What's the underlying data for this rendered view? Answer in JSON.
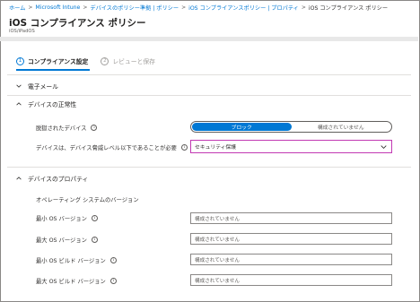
{
  "breadcrumb": {
    "items": [
      "ホーム",
      "Microsoft Intune",
      "デバイスのポリシー準拠 | ポリシー",
      "iOS コンプライアンスポリシー | プロパティ",
      "iOS コンプライアンス ポリシー"
    ],
    "separator": ">"
  },
  "header": {
    "title": "iOS コンプライアンス ポリシー",
    "subtitle": "iOS/iPadOS"
  },
  "wizard": {
    "steps": [
      {
        "number": "1",
        "label": "コンプライアンス設定",
        "state": "active"
      },
      {
        "number": "2",
        "label": "レビューと保存",
        "state": "inactive"
      }
    ]
  },
  "sections": {
    "email": {
      "title": "電子メール",
      "expanded": false
    },
    "device_health": {
      "title": "デバイスの正常性",
      "expanded": true,
      "jailbroken": {
        "label": "脱獄されたデバイス",
        "options": [
          "ブロック",
          "構成されていません"
        ],
        "selected": "ブロック"
      },
      "threat_level": {
        "label": "デバイスは、デバイス脅威レベル以下であることが必要",
        "value": "セキュリティ保護"
      }
    },
    "device_properties": {
      "title": "デバイスのプロパティ",
      "expanded": true,
      "subheading": "オペレーティング システムのバージョン",
      "fields": [
        {
          "label": "最小 OS バージョン",
          "placeholder": "構成されていません"
        },
        {
          "label": "最大 OS バージョン",
          "placeholder": "構成されていません"
        },
        {
          "label": "最小 OS ビルド バージョン",
          "placeholder": "構成されていません"
        },
        {
          "label": "最大 OS ビルド バージョン",
          "placeholder": "構成されていません"
        }
      ]
    }
  },
  "icons": {
    "info": "i",
    "chevron_down": "chevron-down-icon",
    "chevron_up": "chevron-up-icon"
  },
  "colors": {
    "accent": "#0078d4",
    "focus_border": "#c239b3",
    "link": "#0078d4"
  }
}
